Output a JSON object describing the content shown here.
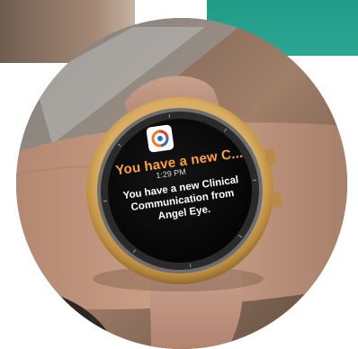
{
  "notification": {
    "title": "You have a new C...",
    "time": "1:29 PM",
    "body": "You have a new Clinical Communication from Angel Eye.",
    "app_icon": "angel-eye-app-icon"
  },
  "colors": {
    "title_accent": "#ffa23a",
    "watch_bezel": "#c79a52",
    "strap": "#c9a28e",
    "screen": "#0b0b0b"
  }
}
